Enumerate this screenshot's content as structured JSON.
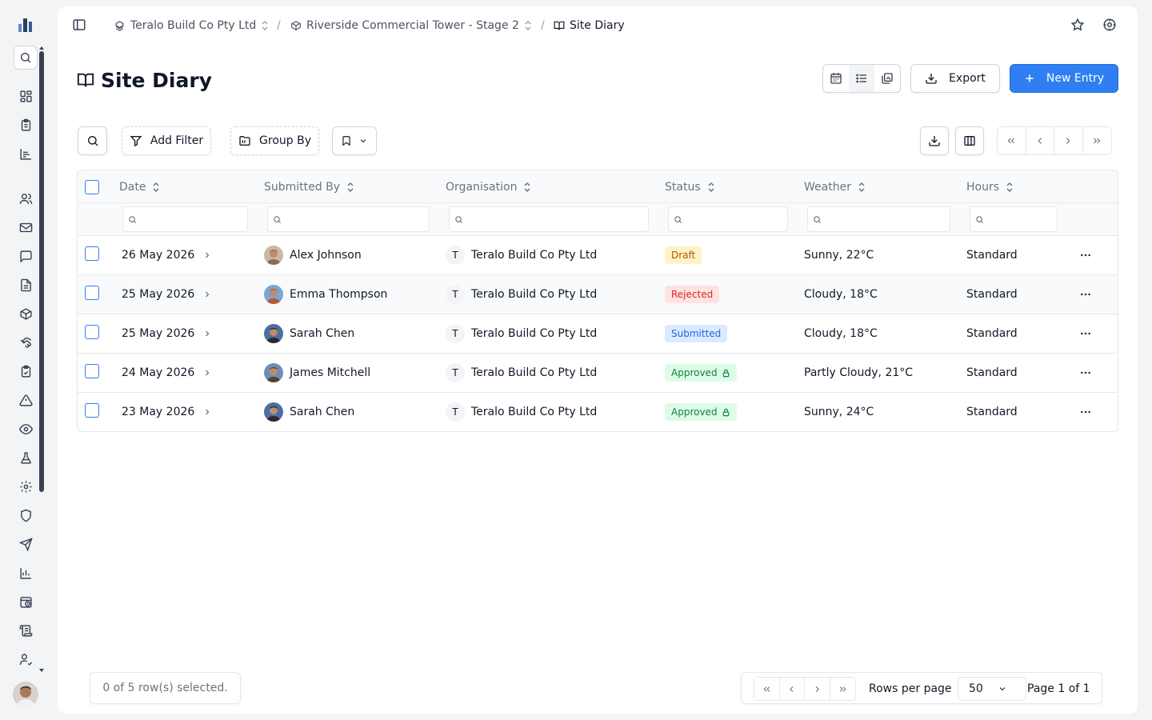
{
  "breadcrumb": {
    "company": "Teralo Build Co Pty Ltd",
    "project": "Riverside Commercial Tower - Stage 2",
    "page": "Site Diary",
    "separator": "/"
  },
  "page_title": "Site Diary",
  "actions": {
    "export_label": "Export",
    "new_entry_label": "New Entry"
  },
  "toolbar": {
    "add_filter_label": "Add Filter",
    "group_by_label": "Group By"
  },
  "table": {
    "columns": [
      "Date",
      "Submitted By",
      "Organisation",
      "Status",
      "Weather",
      "Hours"
    ],
    "rows": [
      {
        "date": "26 May 2026",
        "submitted_by": "Alex Johnson",
        "org_initial": "T",
        "organisation": "Teralo Build Co Pty Ltd",
        "status": "Draft",
        "weather": "Sunny, 22°C",
        "hours": "Standard"
      },
      {
        "date": "25 May 2026",
        "submitted_by": "Emma Thompson",
        "org_initial": "T",
        "organisation": "Teralo Build Co Pty Ltd",
        "status": "Rejected",
        "weather": "Cloudy, 18°C",
        "hours": "Standard"
      },
      {
        "date": "25 May 2026",
        "submitted_by": "Sarah Chen",
        "org_initial": "T",
        "organisation": "Teralo Build Co Pty Ltd",
        "status": "Submitted",
        "weather": "Cloudy, 18°C",
        "hours": "Standard"
      },
      {
        "date": "24 May 2026",
        "submitted_by": "James Mitchell",
        "org_initial": "T",
        "organisation": "Teralo Build Co Pty Ltd",
        "status": "Approved",
        "weather": "Partly Cloudy, 21°C",
        "hours": "Standard"
      },
      {
        "date": "23 May 2026",
        "submitted_by": "Sarah Chen",
        "org_initial": "T",
        "organisation": "Teralo Build Co Pty Ltd",
        "status": "Approved",
        "weather": "Sunny, 24°C",
        "hours": "Standard"
      }
    ]
  },
  "status_colors": {
    "Draft": {
      "bg": "#fef3c7",
      "fg": "#b45309"
    },
    "Rejected": {
      "bg": "#fee2e2",
      "fg": "#dc2626"
    },
    "Submitted": {
      "bg": "#dbeafe",
      "fg": "#2563eb"
    },
    "Approved": {
      "bg": "#dcfce7",
      "fg": "#15803d"
    }
  },
  "footer": {
    "selection_text": "0 of 5 row(s) selected.",
    "rows_per_page_label": "Rows per page",
    "rows_per_page_value": "50",
    "page_text": "Page 1 of 1"
  },
  "icons": {
    "rail": [
      "dashboard-icon",
      "clipboard-icon",
      "chart-icon",
      "users-icon",
      "mail-icon",
      "chat-icon",
      "document-icon",
      "box-icon",
      "handshake-icon",
      "checklist-icon",
      "warning-icon",
      "eye-icon",
      "flask-icon",
      "settings-icon",
      "shield-icon",
      "send-icon",
      "bar-chart-icon",
      "calendar-clock-icon",
      "scroll-icon",
      "user-check-icon"
    ]
  },
  "colors": {
    "accent": "#2f7ff2"
  }
}
